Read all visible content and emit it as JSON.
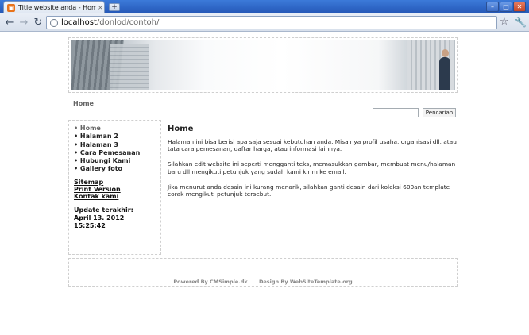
{
  "browser": {
    "tab_title": "Title website anda - Home",
    "url_host": "localhost",
    "url_path": "/donlod/contoh/",
    "newtab_label": "+"
  },
  "page": {
    "breadcrumb": "Home",
    "search": {
      "placeholder": "",
      "button_label": "Pencarian"
    },
    "menu": [
      {
        "label": "Home",
        "active": true
      },
      {
        "label": "Halaman 2"
      },
      {
        "label": "Halaman 3"
      },
      {
        "label": "Cara Pemesanan"
      },
      {
        "label": "Hubungi Kami"
      },
      {
        "label": "Gallery foto"
      }
    ],
    "sidelinks": {
      "sitemap": "Sitemap",
      "print_version": "Print Version",
      "contact": "Kontak kami"
    },
    "update_label": "Update terakhir:",
    "update_date": "April 13. 2012 15:25:42",
    "content": {
      "title": "Home",
      "paragraphs": [
        "Halaman ini bisa berisi apa saja sesuai kebutuhan anda. Misalnya profil usaha, organisasi dll, atau tata cara pemesanan, daftar harga, atau informasi lainnya.",
        "Silahkan edit website ini seperti mengganti teks, memasukkan gambar, membuat menu/halaman baru dll mengikuti petunjuk yang sudah kami kirim ke email.",
        "Jika menurut anda desain ini kurang menarik, silahkan ganti desain dari koleksi 600an template corak mengikuti petunjuk tersebut."
      ]
    },
    "footer": {
      "powered": "Powered By CMSimple.dk",
      "design": "Design By WebSiteTemplate.org"
    }
  }
}
